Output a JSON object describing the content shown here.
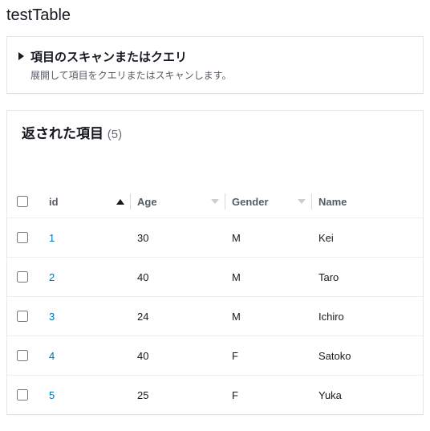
{
  "pageTitle": "testTable",
  "scanPanel": {
    "title": "項目のスキャンまたはクエリ",
    "subtitle": "展開して項目をクエリまたはスキャンします。"
  },
  "results": {
    "heading": "返された項目",
    "count": "(5)"
  },
  "columns": {
    "id": "id",
    "age": "Age",
    "gender": "Gender",
    "name": "Name"
  },
  "rows": [
    {
      "id": "1",
      "age": "30",
      "gender": "M",
      "name": "Kei"
    },
    {
      "id": "2",
      "age": "40",
      "gender": "M",
      "name": "Taro"
    },
    {
      "id": "3",
      "age": "24",
      "gender": "M",
      "name": "Ichiro"
    },
    {
      "id": "4",
      "age": "40",
      "gender": "F",
      "name": "Satoko"
    },
    {
      "id": "5",
      "age": "25",
      "gender": "F",
      "name": "Yuka"
    }
  ]
}
